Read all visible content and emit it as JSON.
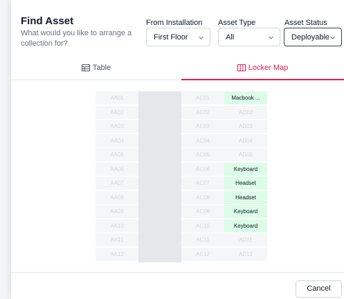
{
  "dialog": {
    "title": "Find Asset",
    "subtitle": "What would you like to arrange a collection for?"
  },
  "filters": {
    "installation": {
      "label": "From Installation",
      "value": "First Floor"
    },
    "asset_type": {
      "label": "Asset Type",
      "value": "All"
    },
    "asset_status": {
      "label": "Asset Status",
      "value": "Deployable"
    }
  },
  "tabs": {
    "table": {
      "label": "Table",
      "icon": "table-icon"
    },
    "locker_map": {
      "label": "Locker Map",
      "icon": "locker-map-icon",
      "active": true
    }
  },
  "locker_map": {
    "column_aa": [
      "AA01",
      "AA02",
      "AA03",
      "AA04",
      "AA05",
      "AA06",
      "AA07",
      "AA08",
      "AA09",
      "AA10",
      "AA11",
      "AA12"
    ],
    "column_ac": [
      "AC01",
      "AC02",
      "AC03",
      "AC04",
      "AC05",
      "AC06",
      "AC07",
      "AC08",
      "AC09",
      "AC10",
      "AC11",
      "AC12"
    ],
    "column_ad": [
      "Macbook ...",
      "AD02",
      "AD03",
      "AD04",
      "AD05",
      "Keyboard",
      "Headset",
      "Headset",
      "Keyboard",
      "Keyboard",
      "AD11",
      "AD12"
    ],
    "column_ad_occupied": [
      true,
      false,
      false,
      false,
      false,
      true,
      true,
      true,
      true,
      true,
      false,
      false
    ]
  },
  "footer": {
    "cancel_label": "Cancel"
  },
  "colors": {
    "accent": "#e11d48",
    "occupied": "#dcfce7",
    "empty": "#f5f6f7"
  }
}
